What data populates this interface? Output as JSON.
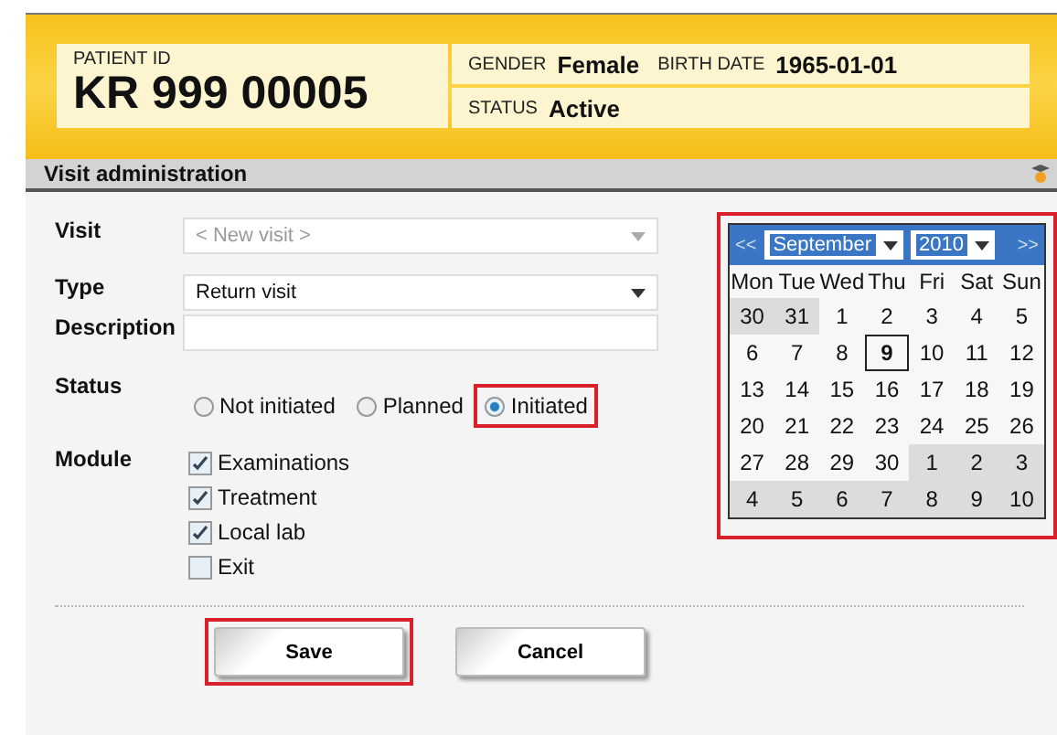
{
  "patient": {
    "id_label": "PATIENT ID",
    "id": "KR 999 00005",
    "gender_label": "GENDER",
    "gender": "Female",
    "birth_label": "BIRTH DATE",
    "birth": "1965-01-01",
    "status_label": "STATUS",
    "status": "Active"
  },
  "section": {
    "title": "Visit administration"
  },
  "form": {
    "visit": {
      "label": "Visit",
      "placeholder": "< New visit >"
    },
    "type": {
      "label": "Type",
      "value": "Return visit"
    },
    "description": {
      "label": "Description"
    },
    "status": {
      "label": "Status",
      "options": [
        {
          "label": "Not initiated",
          "selected": false,
          "highlighted": false
        },
        {
          "label": "Planned",
          "selected": false,
          "highlighted": false
        },
        {
          "label": "Initiated",
          "selected": true,
          "highlighted": true
        }
      ]
    },
    "module": {
      "label": "Module",
      "options": [
        {
          "label": "Examinations",
          "checked": true
        },
        {
          "label": "Treatment",
          "checked": true
        },
        {
          "label": "Local lab",
          "checked": true
        },
        {
          "label": "Exit",
          "checked": false
        }
      ]
    }
  },
  "buttons": [
    {
      "label": "Save",
      "highlighted": true
    },
    {
      "label": "Cancel",
      "highlighted": false
    }
  ],
  "calendar": {
    "highlighted": true,
    "prev": "<<",
    "next": ">>",
    "month": "September",
    "year": "2010",
    "weekdays": [
      "Mon",
      "Tue",
      "Wed",
      "Thu",
      "Fri",
      "Sat",
      "Sun"
    ],
    "weeks": [
      [
        {
          "day": "30",
          "outside": true,
          "selected": false
        },
        {
          "day": "31",
          "outside": true,
          "selected": false
        },
        {
          "day": "1",
          "outside": false,
          "selected": false
        },
        {
          "day": "2",
          "outside": false,
          "selected": false
        },
        {
          "day": "3",
          "outside": false,
          "selected": false
        },
        {
          "day": "4",
          "outside": false,
          "selected": false
        },
        {
          "day": "5",
          "outside": false,
          "selected": false
        }
      ],
      [
        {
          "day": "6",
          "outside": false,
          "selected": false
        },
        {
          "day": "7",
          "outside": false,
          "selected": false
        },
        {
          "day": "8",
          "outside": false,
          "selected": false
        },
        {
          "day": "9",
          "outside": false,
          "selected": true
        },
        {
          "day": "10",
          "outside": false,
          "selected": false
        },
        {
          "day": "11",
          "outside": false,
          "selected": false
        },
        {
          "day": "12",
          "outside": false,
          "selected": false
        }
      ],
      [
        {
          "day": "13",
          "outside": false,
          "selected": false
        },
        {
          "day": "14",
          "outside": false,
          "selected": false
        },
        {
          "day": "15",
          "outside": false,
          "selected": false
        },
        {
          "day": "16",
          "outside": false,
          "selected": false
        },
        {
          "day": "17",
          "outside": false,
          "selected": false
        },
        {
          "day": "18",
          "outside": false,
          "selected": false
        },
        {
          "day": "19",
          "outside": false,
          "selected": false
        }
      ],
      [
        {
          "day": "20",
          "outside": false,
          "selected": false
        },
        {
          "day": "21",
          "outside": false,
          "selected": false
        },
        {
          "day": "22",
          "outside": false,
          "selected": false
        },
        {
          "day": "23",
          "outside": false,
          "selected": false
        },
        {
          "day": "24",
          "outside": false,
          "selected": false
        },
        {
          "day": "25",
          "outside": false,
          "selected": false
        },
        {
          "day": "26",
          "outside": false,
          "selected": false
        }
      ],
      [
        {
          "day": "27",
          "outside": false,
          "selected": false
        },
        {
          "day": "28",
          "outside": false,
          "selected": false
        },
        {
          "day": "29",
          "outside": false,
          "selected": false
        },
        {
          "day": "30",
          "outside": false,
          "selected": false
        },
        {
          "day": "1",
          "outside": true,
          "selected": false
        },
        {
          "day": "2",
          "outside": true,
          "selected": false
        },
        {
          "day": "3",
          "outside": true,
          "selected": false
        }
      ],
      [
        {
          "day": "4",
          "outside": true,
          "selected": false
        },
        {
          "day": "5",
          "outside": true,
          "selected": false
        },
        {
          "day": "6",
          "outside": true,
          "selected": false
        },
        {
          "day": "7",
          "outside": true,
          "selected": false
        },
        {
          "day": "8",
          "outside": true,
          "selected": false
        },
        {
          "day": "9",
          "outside": true,
          "selected": false
        },
        {
          "day": "10",
          "outside": true,
          "selected": false
        }
      ]
    ]
  }
}
